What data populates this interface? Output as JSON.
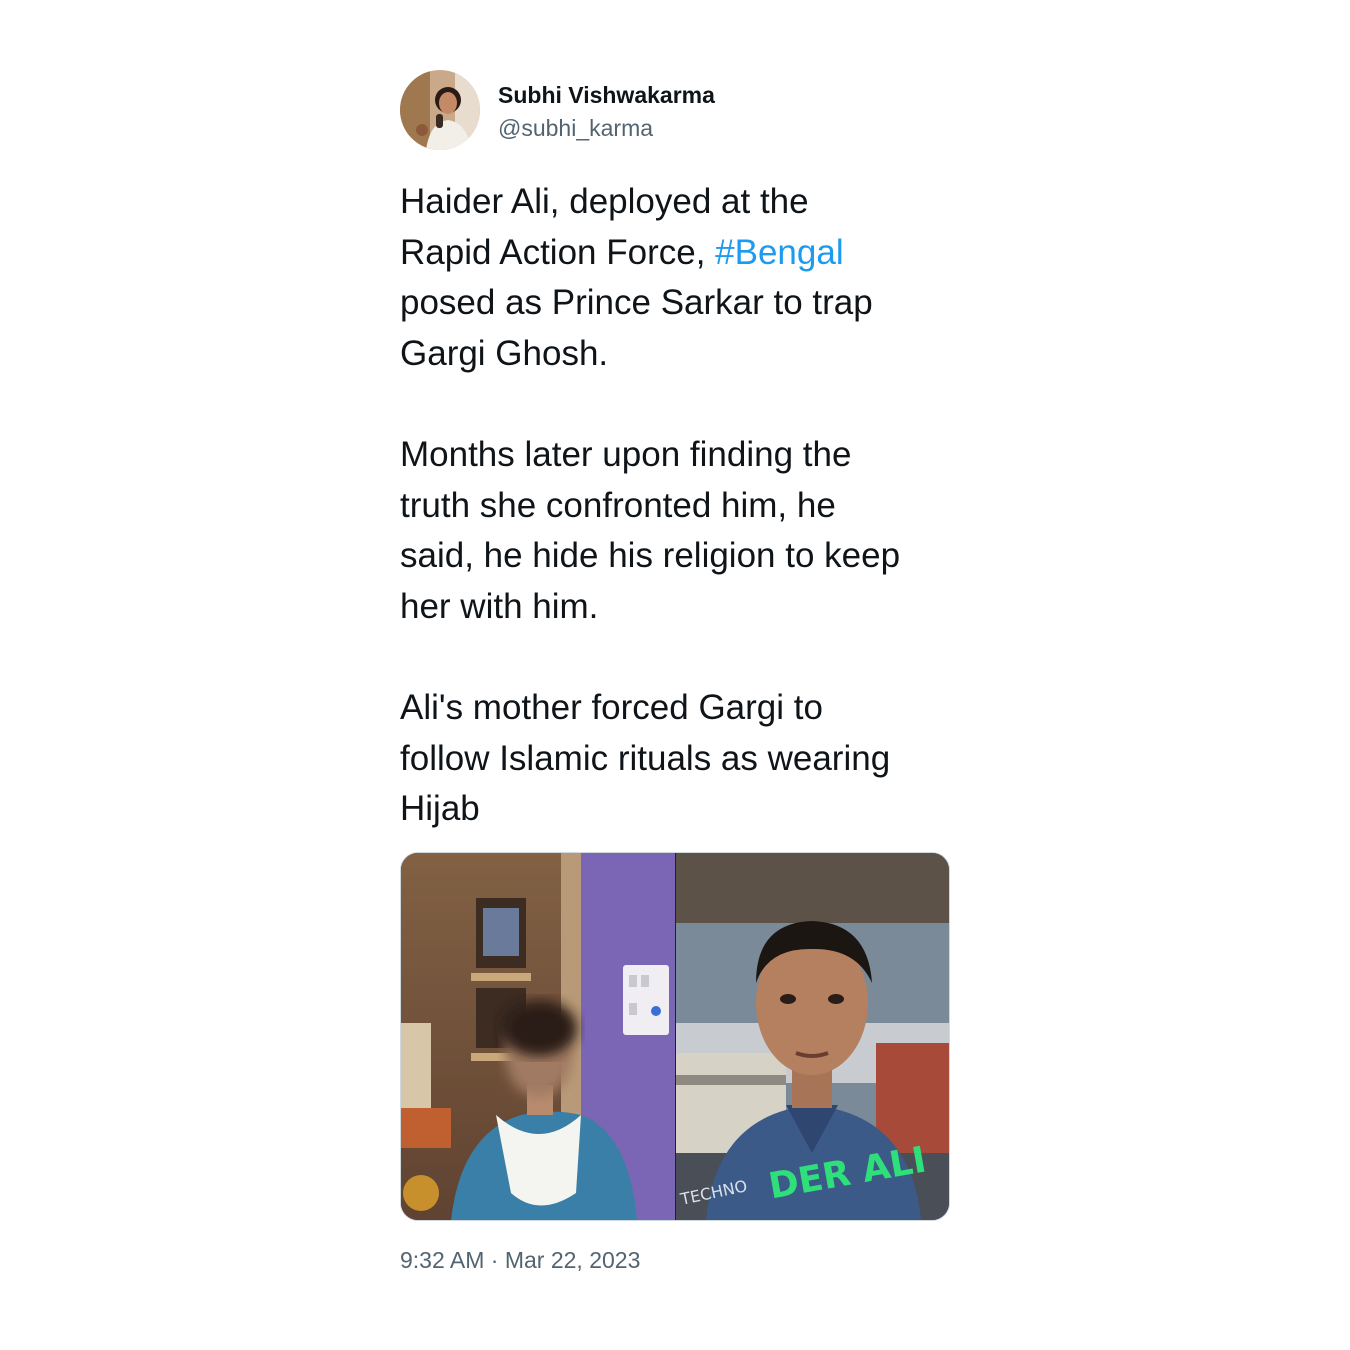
{
  "author": {
    "name": "Subhi Vishwakarma",
    "handle": "@subhi_karma"
  },
  "tweet": {
    "paragraphs": [
      {
        "lines": [
          {
            "text": "Haider Ali, deployed at the"
          },
          {
            "text": "Rapid Action Force, ",
            "hashtag": "#Bengal"
          },
          {
            "text": "posed as Prince Sarkar to trap"
          },
          {
            "text": "Gargi Ghosh."
          }
        ]
      },
      {
        "lines": [
          {
            "text": "Months later upon finding the"
          },
          {
            "text": "truth she confronted him, he"
          },
          {
            "text": "said, he hide his religion to keep"
          },
          {
            "text": "her with him."
          }
        ]
      },
      {
        "lines": [
          {
            "text": "Ali's mother forced Gargi to"
          },
          {
            "text": "follow Islamic rituals as wearing"
          },
          {
            "text": "Hijab"
          }
        ]
      }
    ],
    "timestamp": "9:32 AM · Mar 22, 2023"
  },
  "media": {
    "right_overlay_text": "DER ALI",
    "shirt_text": "TECHNO"
  },
  "colors": {
    "hashtag": "#1d9bf0",
    "secondary_text": "#536471",
    "overlay_text": "#2fe07a",
    "wall_purple": "#7b66b5"
  }
}
